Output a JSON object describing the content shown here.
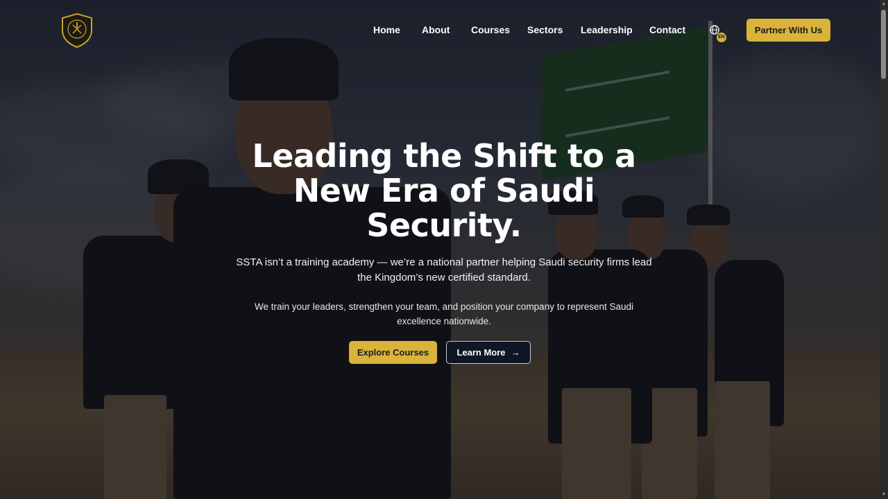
{
  "header": {
    "nav": [
      {
        "label": "Home"
      },
      {
        "label": "About"
      },
      {
        "label": "Courses"
      },
      {
        "label": "Sectors"
      },
      {
        "label": "Leadership"
      },
      {
        "label": "Contact"
      }
    ],
    "language_badge": "EN",
    "partner_button": "Partner With Us"
  },
  "hero": {
    "title_line1": "Leading the Shift to a",
    "title_line2": "New Era of Saudi",
    "title_line3": "Security.",
    "subtitle_line1": "SSTA isn’t a training academy — we’re a national partner helping Saudi security firms lead",
    "subtitle_line2": "the Kingdom’s new certified standard.",
    "body_line1": "We train your leaders, strengthen your team, and position your company to represent Saudi",
    "body_line2": "excellence nationwide.",
    "explore_button": "Explore Courses",
    "learn_button": "Learn More"
  },
  "colors": {
    "accent": "#d9b33a",
    "dark_button": "#111626",
    "text": "#ffffff"
  },
  "icons": {
    "logo": "shield-emblem-icon",
    "language": "globe-icon",
    "learn_arrow": "arrow-right-icon"
  }
}
